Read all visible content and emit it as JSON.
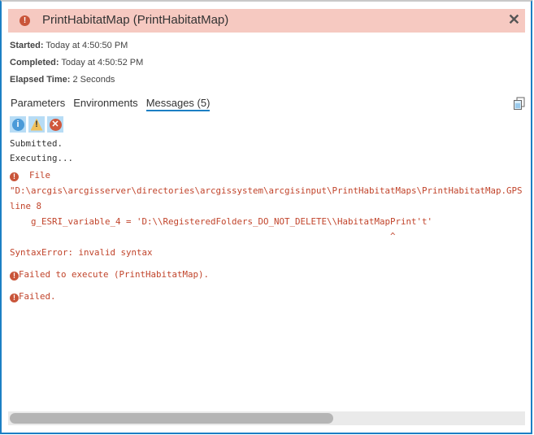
{
  "header": {
    "title": "PrintHabitatMap (PrintHabitatMap)",
    "status": "error",
    "close": "✕"
  },
  "meta": {
    "started_label": "Started:",
    "started": "Today at 4:50:50 PM",
    "completed_label": "Completed:",
    "completed": "Today at 4:50:52 PM",
    "elapsed_label": "Elapsed Time:",
    "elapsed": "2 Seconds"
  },
  "tabs": [
    {
      "label": "Parameters"
    },
    {
      "label": "Environments"
    },
    {
      "label": "Messages (5)",
      "active": true
    }
  ],
  "filters": {
    "info": "i",
    "warning": "!",
    "error": "✕"
  },
  "messages": {
    "l1": "Submitted.",
    "l2": "Executing...",
    "l3": " File",
    "l4": "\"D:\\arcgis\\arcgisserver\\directories\\arcgissystem\\arcgisinput\\PrintHabitatMaps\\PrintHabitatMap.GPS",
    "l5": "line 8",
    "l6": "    g_ESRI_variable_4 = 'D:\\\\RegisteredFolders_DO_NOT_DELETE\\\\HabitatMapPrint't'",
    "l7": "                                                                        ^",
    "l8": "SyntaxError: invalid syntax",
    "l9": "Failed to execute (PrintHabitatMap).",
    "l10": "Failed."
  },
  "scrollbar": {
    "position_fraction": 0.0,
    "visible_fraction": 0.63
  },
  "colors": {
    "error": "#c1442b",
    "accent": "#1c7fc4",
    "header_bg": "#f6c9c1"
  }
}
